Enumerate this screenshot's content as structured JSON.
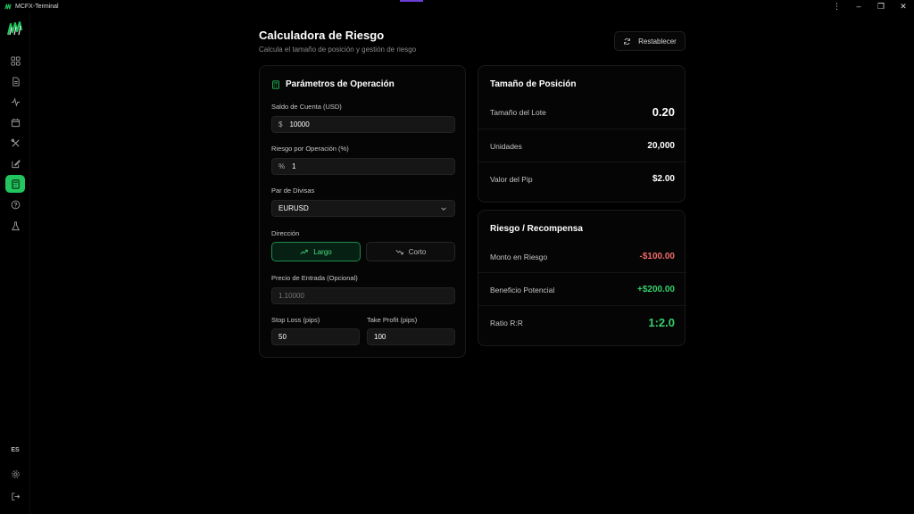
{
  "window": {
    "app_name": "MCFX-Terminal",
    "controls": [
      "⋮",
      "–",
      "❐",
      "✕"
    ]
  },
  "sidebar": {
    "items": [
      {
        "icon": "dashboard-icon"
      },
      {
        "icon": "document-icon"
      },
      {
        "icon": "activity-icon"
      },
      {
        "icon": "calendar-icon"
      },
      {
        "icon": "tools-icon"
      },
      {
        "icon": "edit-icon"
      },
      {
        "icon": "calculator-icon",
        "active": true
      },
      {
        "icon": "help-icon"
      },
      {
        "icon": "flask-icon"
      }
    ],
    "language": "ES",
    "settings_icon": "gear-icon",
    "logout_icon": "logout-icon"
  },
  "header": {
    "title": "Calculadora de Riesgo",
    "subtitle": "Calcula el tamaño de posición y gestión de riesgo",
    "reset_label": "Restablecer"
  },
  "params": {
    "title": "Parámetros de Operación",
    "balance": {
      "label": "Saldo de Cuenta (USD)",
      "prefix": "$",
      "value": "10000"
    },
    "risk": {
      "label": "Riesgo por Operación (%)",
      "prefix": "%",
      "value": "1"
    },
    "pair": {
      "label": "Par de Divisas",
      "value": "EURUSD"
    },
    "direction": {
      "label": "Dirección",
      "long_label": "Largo",
      "short_label": "Corto",
      "selected": "long"
    },
    "entry": {
      "label": "Precio de Entrada (Opcional)",
      "placeholder": "1.10000"
    },
    "stop_loss": {
      "label": "Stop Loss (pips)",
      "value": "50"
    },
    "take_profit": {
      "label": "Take Profit (pips)",
      "value": "100"
    }
  },
  "position": {
    "title": "Tamaño de Posición",
    "rows": [
      {
        "label": "Tamaño del Lote",
        "value": "0.20"
      },
      {
        "label": "Unidades",
        "value": "20,000"
      },
      {
        "label": "Valor del Pip",
        "value": "$2.00"
      }
    ]
  },
  "risk_reward": {
    "title": "Riesgo / Recompensa",
    "rows": [
      {
        "label": "Monto en Riesgo",
        "value": "-$100.00",
        "color": "#f06a6a"
      },
      {
        "label": "Beneficio Potencial",
        "value": "+$200.00",
        "color": "#34d06e"
      },
      {
        "label": "Ratio R:R",
        "value": "1:2.0",
        "color": "#34d06e"
      }
    ]
  }
}
